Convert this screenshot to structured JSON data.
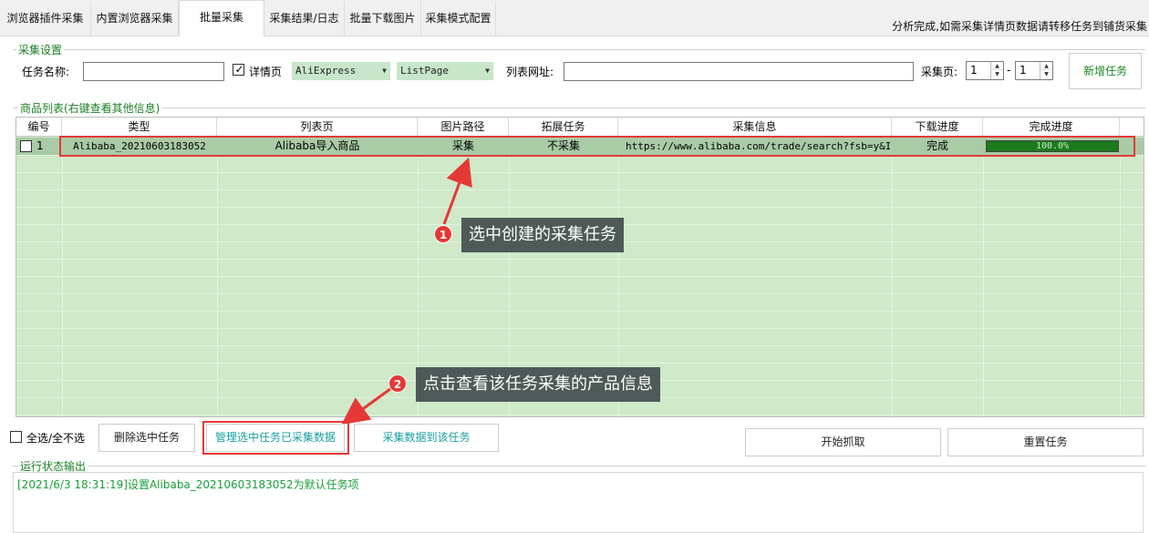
{
  "tabs": [
    {
      "label": "浏览器插件采集"
    },
    {
      "label": "内置浏览器采集"
    },
    {
      "label": "批量采集"
    },
    {
      "label": "采集结果/日志"
    },
    {
      "label": "批量下载图片"
    },
    {
      "label": "采集模式配置"
    }
  ],
  "active_tab": "批量采集",
  "top_status": "分析完成,如需采集详情页数据请转移任务到铺货采集",
  "settings": {
    "group_title": "采集设置",
    "task_name_label": "任务名称:",
    "task_name_value": "",
    "detail_page_label": "详情页",
    "detail_page_checked": true,
    "platform_value": "AliExpress",
    "page_type_value": "ListPage",
    "list_url_label": "列表网址:",
    "list_url_value": "",
    "pages_label": "采集页:",
    "page_from": "1",
    "page_to": "1",
    "page_sep": "-",
    "new_task_button": "新增任务"
  },
  "product_list": {
    "group_title": "商品列表(右键查看其他信息)",
    "columns": [
      "编号",
      "类型",
      "列表页",
      "图片路径",
      "拓展任务",
      "采集信息",
      "下载进度",
      "完成进度"
    ],
    "rows": [
      {
        "checked": false,
        "id": "1",
        "type": "Alibaba_20210603183052",
        "list_page": "Alibaba导入商品",
        "image_path": "采集",
        "extend_task": "不采集",
        "collect_info": "https://www.alibaba.com/trade/search?fsb=y&I...",
        "download_progress": "完成",
        "completion_percent": 100,
        "completion_text": "100.0%"
      }
    ]
  },
  "annotations": {
    "step1_number": "1",
    "step1_text": "选中创建的采集任务",
    "step2_number": "2",
    "step2_text": "点击查看该任务采集的产品信息"
  },
  "actions": {
    "select_all_label": "全选/全不选",
    "delete_selected": "删除选中任务",
    "manage_collected": "管理选中任务已采集数据",
    "collect_to_task": "采集数据到该任务",
    "start_crawl": "开始抓取",
    "reset_task": "重置任务"
  },
  "log": {
    "group_title": "运行状态输出",
    "lines": [
      "[2021/6/3 18:31:19]设置Alibaba_20210603183052为默认任务项"
    ]
  },
  "colors": {
    "grid_bg": "#cfe9c9",
    "selected_row": "#a9cba6",
    "highlight_red": "#e53935",
    "group_title_green": "#1a7f25",
    "progress_fill": "#1b7a1b"
  }
}
